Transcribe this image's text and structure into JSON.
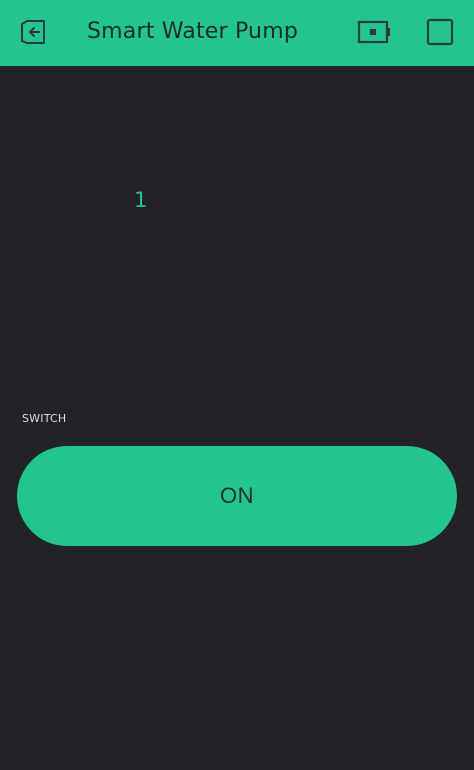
{
  "header": {
    "title": "Smart Water Pump",
    "icons": {
      "back": "exit-icon",
      "device": "device-icon",
      "stop": "stop-square-icon"
    },
    "background_color": "#23c48e"
  },
  "value_display": {
    "value": "1",
    "color": "#23c48e"
  },
  "switch_widget": {
    "label": "SWITCH",
    "button_text": "ON",
    "color": "#23c48e"
  },
  "background_color": "#212329"
}
